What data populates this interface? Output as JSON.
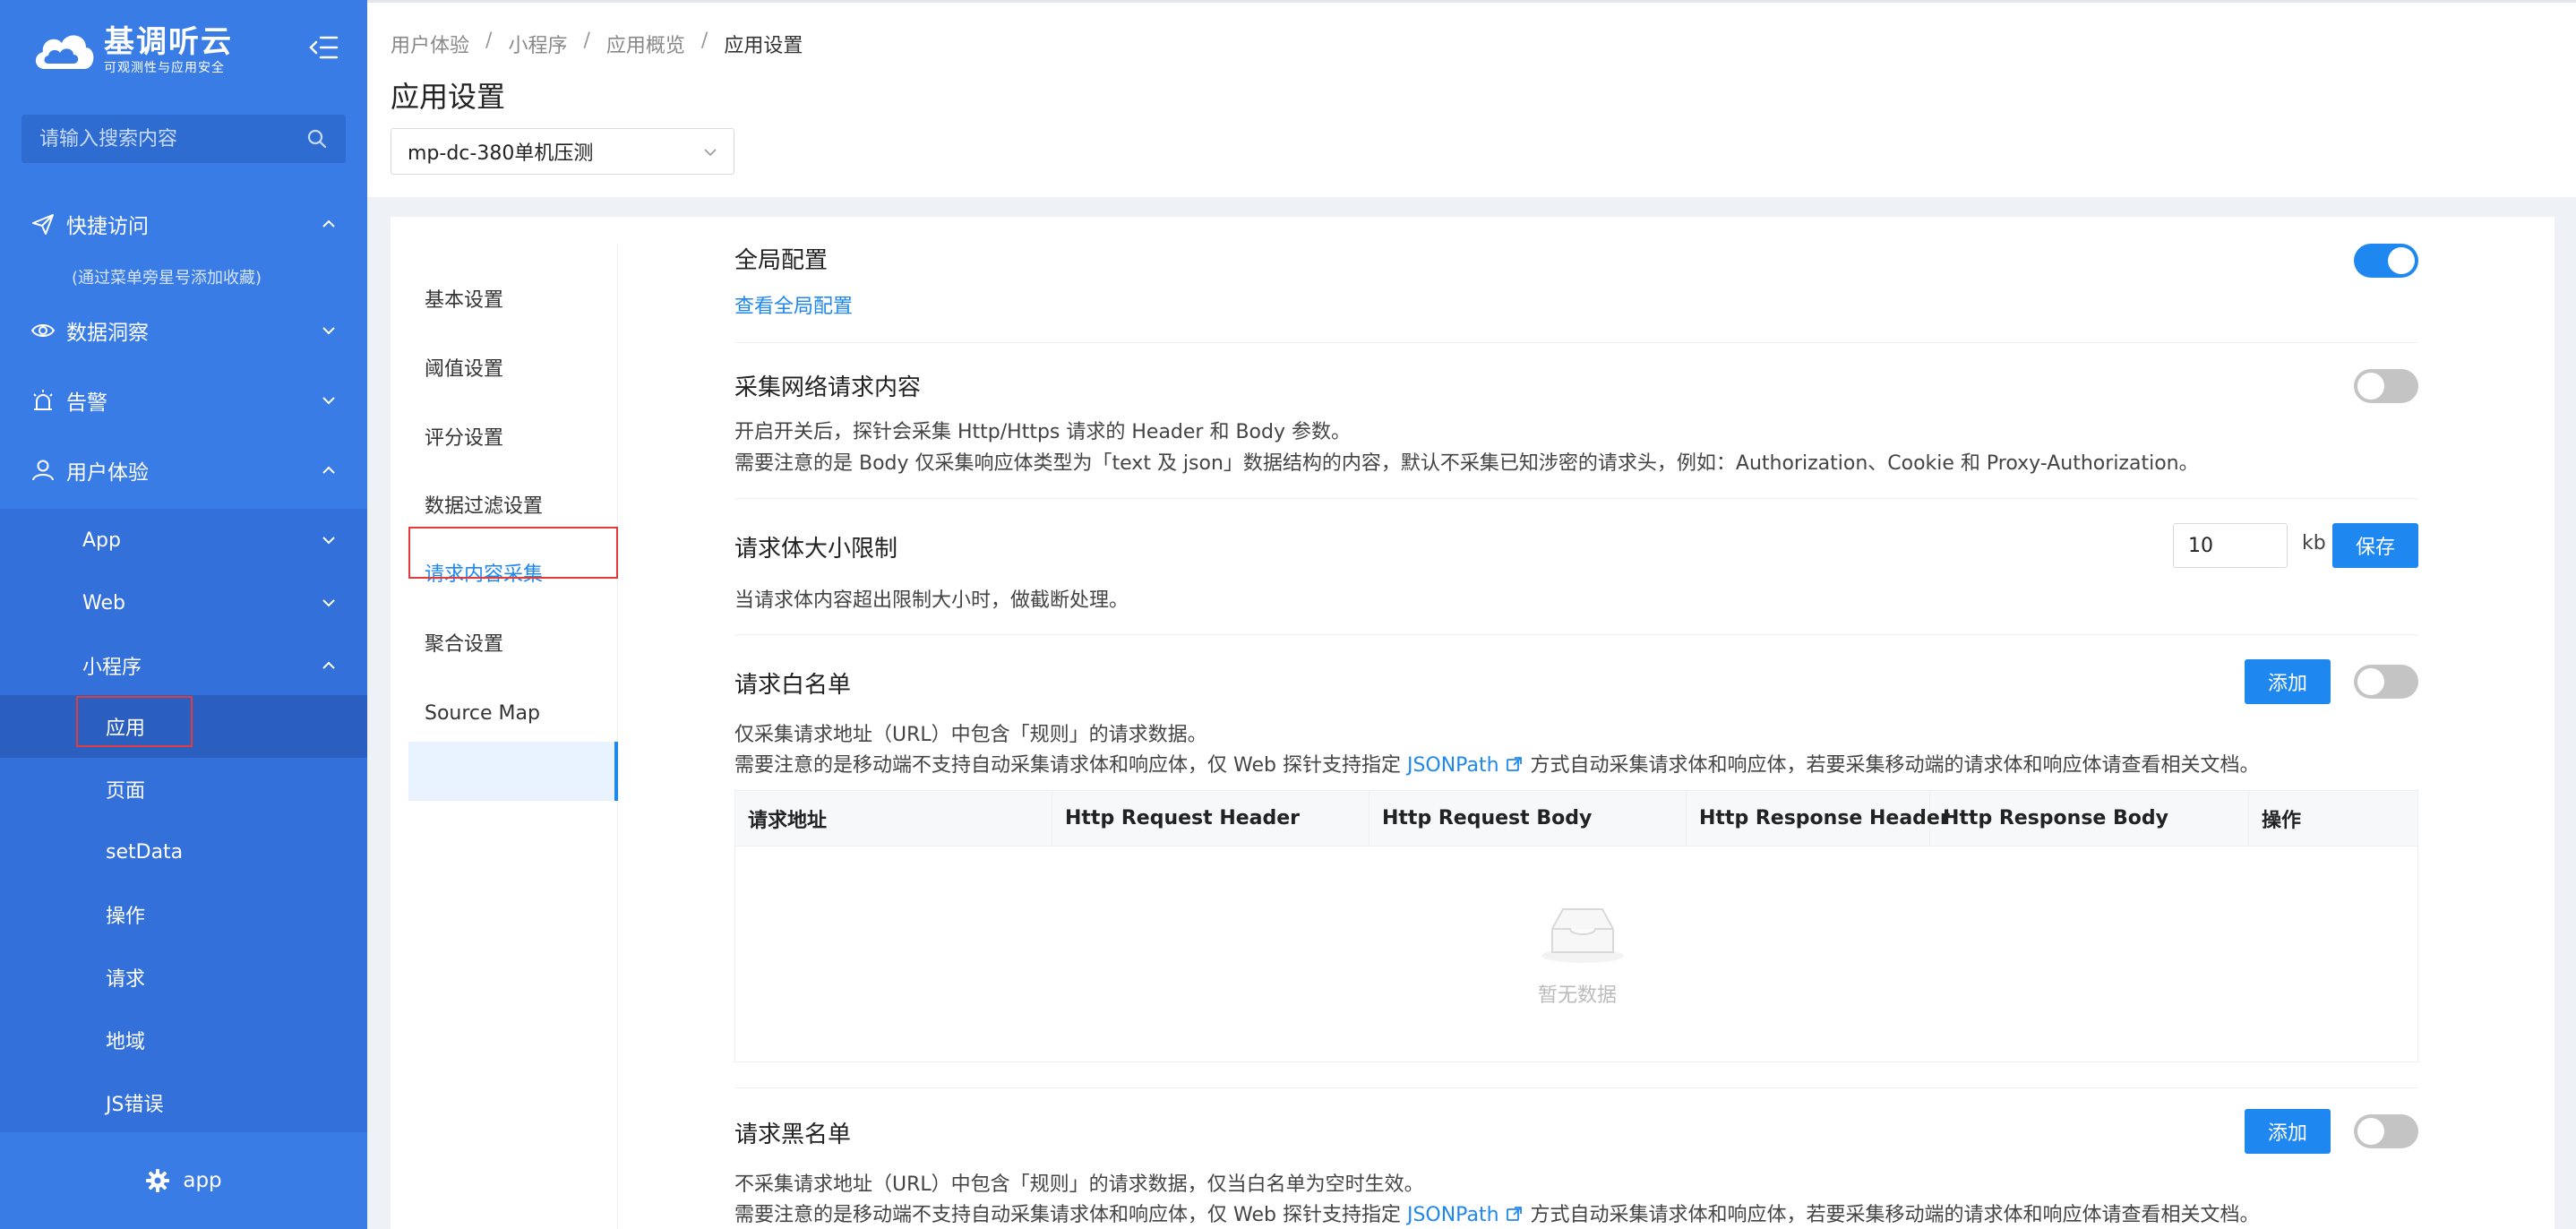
{
  "brand": {
    "name": "基调听云",
    "tagline": "可观测性与应用安全"
  },
  "search": {
    "placeholder": "请输入搜索内容"
  },
  "sidebar": {
    "groups": [
      {
        "label": "快捷访问",
        "icon": "send-icon",
        "expanded": true
      },
      {
        "label": "数据洞察",
        "icon": "eye-icon",
        "expanded": false
      },
      {
        "label": "告警",
        "icon": "alarm-light-icon",
        "expanded": false
      },
      {
        "label": "用户体验",
        "icon": "user-icon",
        "expanded": true
      }
    ],
    "quick_access_hint": "(通过菜单旁星号添加收藏)",
    "sub_items": [
      {
        "label": "App",
        "expanded": false
      },
      {
        "label": "Web",
        "expanded": false
      },
      {
        "label": "小程序",
        "expanded": true
      }
    ],
    "leaves": [
      "应用",
      "页面",
      "setData",
      "操作",
      "请求",
      "地域",
      "JS错误"
    ],
    "active_leaf": "应用",
    "bottom_label": "app"
  },
  "header": {
    "breadcrumb": [
      "用户体验",
      "小程序",
      "应用概览",
      "应用设置"
    ],
    "title": "应用设置",
    "app_select_value": "mp-dc-380单机压测"
  },
  "settings_nav": {
    "items": [
      "基本设置",
      "阈值设置",
      "评分设置",
      "数据过滤设置",
      "请求内容采集",
      "聚合设置",
      "Source Map"
    ],
    "active": "请求内容采集"
  },
  "sections": {
    "global": {
      "title": "全局配置",
      "link": "查看全局配置",
      "enabled": true
    },
    "collect_network": {
      "title": "采集网络请求内容",
      "enabled": false,
      "desc1": "开启开关后，探针会采集 Http/Https 请求的 Header 和 Body 参数。",
      "desc2": "需要注意的是 Body 仅采集响应体类型为「text 及 json」数据结构的内容，默认不采集已知涉密的请求头，例如：Authorization、Cookie 和 Proxy-Authorization。"
    },
    "body_limit": {
      "title": "请求体大小限制",
      "value": "10",
      "unit": "kb",
      "save_label": "保存",
      "desc": "当请求体内容超出限制大小时，做截断处理。"
    },
    "whitelist": {
      "title": "请求白名单",
      "add_label": "添加",
      "enabled": false,
      "desc1": "仅采集请求地址（URL）中包含「规则」的请求数据。",
      "desc2_pre": "需要注意的是移动端不支持自动采集请求体和响应体，仅 Web 探针支持指定 ",
      "desc2_link": "JSONPath",
      "desc2_post": " 方式自动采集请求体和响应体，若要采集移动端的请求体和响应体请查看相关文档。",
      "columns": [
        "请求地址",
        "Http Request Header",
        "Http Request Body",
        "Http Response Header",
        "Http Response Body",
        "操作"
      ],
      "empty_text": "暂无数据"
    },
    "blacklist": {
      "title": "请求黑名单",
      "add_label": "添加",
      "enabled": false,
      "desc1": "不采集请求地址（URL）中包含「规则」的请求数据，仅当白名单为空时生效。",
      "desc2_pre": "需要注意的是移动端不支持自动采集请求体和响应体，仅 Web 探针支持指定 ",
      "desc2_link": "JSONPath",
      "desc2_post": " 方式自动采集请求体和响应体，若要采集移动端的请求体和响应体请查看相关文档。"
    }
  },
  "colors": {
    "sidebar_bg": "#3a7ce6",
    "accent": "#1e88f0",
    "highlight_border": "#e33b3b"
  }
}
